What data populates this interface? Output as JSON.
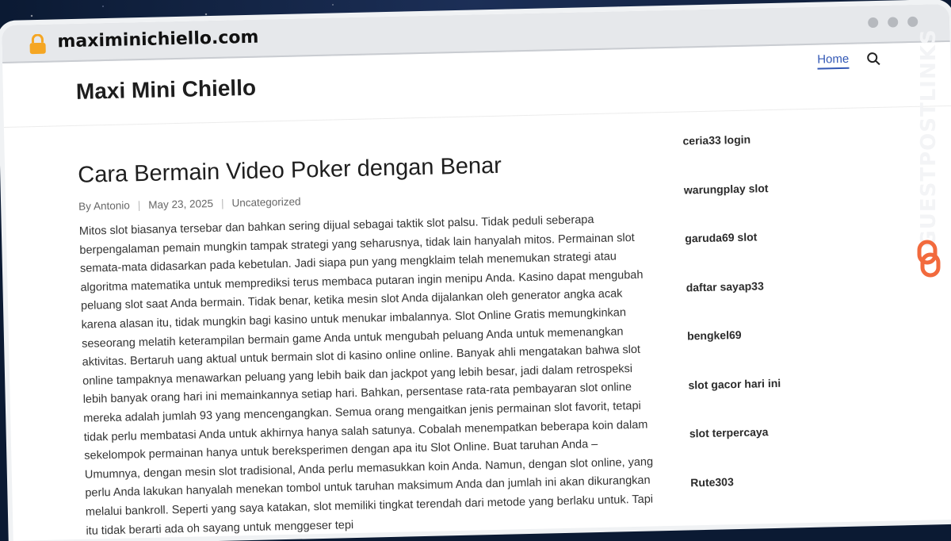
{
  "browser": {
    "url": "maximinichiello.com",
    "lock_icon": "lock-icon"
  },
  "site": {
    "title": "Maxi Mini Chiello",
    "nav": {
      "home_label": "Home",
      "search_icon": "search-icon"
    }
  },
  "post": {
    "title": "Cara Bermain Video Poker dengan Benar",
    "author": "By Antonio",
    "date": "May 23, 2025",
    "category": "Uncategorized",
    "body": "Mitos slot biasanya tersebar dan bahkan sering dijual sebagai taktik slot palsu. Tidak peduli seberapa berpengalaman pemain mungkin tampak strategi yang seharusnya, tidak lain hanyalah mitos. Permainan slot semata-mata didasarkan pada kebetulan. Jadi siapa pun yang mengklaim telah menemukan strategi atau algoritma matematika untuk memprediksi terus membaca putaran ingin menipu Anda. Kasino dapat mengubah peluang slot saat Anda bermain. Tidak benar, ketika mesin slot Anda dijalankan oleh generator angka acak karena alasan itu, tidak mungkin bagi kasino untuk menukar imbalannya. Slot Online Gratis memungkinkan seseorang melatih keterampilan bermain game Anda untuk mengubah peluang Anda untuk memenangkan aktivitas. Bertaruh uang aktual untuk bermain slot di kasino online online. Banyak ahli mengatakan bahwa slot online tampaknya menawarkan peluang yang lebih baik dan jackpot yang lebih besar, jadi dalam retrospeksi lebih banyak orang hari ini memainkannya setiap hari. Bahkan, persentase rata-rata pembayaran slot online mereka adalah jumlah 93 yang mencengangkan. Semua orang mengaitkan jenis permainan slot favorit, tetapi tidak perlu membatasi Anda untuk akhirnya hanya salah satunya. Cobalah menempatkan beberapa koin dalam sekelompok permainan hanya untuk bereksperimen dengan apa itu Slot Online. Buat taruhan Anda – Umumnya, dengan mesin slot tradisional, Anda perlu memasukkan koin Anda. Namun, dengan slot online, yang perlu Anda lakukan hanyalah menekan tombol untuk taruhan maksimum Anda dan jumlah ini akan dikurangkan melalui bankroll. Seperti yang saya katakan, slot memiliki tingkat terendah dari metode yang berlaku untuk. Tapi itu tidak berarti ada oh sayang untuk menggeser tepi"
  },
  "sidebar": {
    "links": [
      "ceria33 login",
      "warungplay slot",
      "garuda69 slot",
      "daftar sayap33",
      "bengkel69",
      "slot gacor hari ini",
      "slot terpercaya",
      "Rute303"
    ]
  },
  "brand": {
    "name": "GUESTPOSTLINKS",
    "accent": "#f26a3d",
    "logo_icon": "chain-link-icon"
  }
}
